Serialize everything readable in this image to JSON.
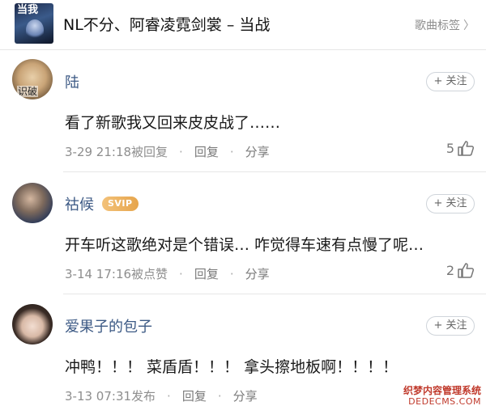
{
  "header": {
    "cover_text": "当我",
    "title": "NL不分、阿睿凌霓剑裳 – 当战",
    "tags_label": "歌曲标签",
    "tags_chevron": "〉"
  },
  "comments": [
    {
      "username": "陆",
      "avatar_label": "识破",
      "follow_label": "+ 关注",
      "text": "看了新歌我又回来皮皮战了……",
      "date": "3-29 21:18被回复",
      "reply_label": "回复",
      "share_label": "分享",
      "likes": "5"
    },
    {
      "username": "祜候",
      "badge": "SVIP",
      "follow_label": "+ 关注",
      "text": "开车听这歌绝对是个错误… 咋觉得车速有点慢了呢…",
      "date": "3-14 17:16被点赞",
      "reply_label": "回复",
      "share_label": "分享",
      "likes": "2"
    },
    {
      "username": "爱果子的包子",
      "follow_label": "+ 关注",
      "text": "冲鸭！！！ 菜盾盾！！！ 拿头擦地板啊！！！！",
      "date": "3-13 07:31发布",
      "reply_label": "回复",
      "share_label": "分享"
    }
  ],
  "watermark": {
    "line1": "织梦内容管理系统",
    "line2": "DEDECMS.COM"
  },
  "colors": {
    "username": "#3d5a85",
    "svip_badge": "#e6a54c",
    "meta_text": "#8e8e8e",
    "watermark": "#c0392b"
  },
  "icons": {
    "like": "thumbs-up-icon",
    "chevron": "chevron-right-icon"
  }
}
